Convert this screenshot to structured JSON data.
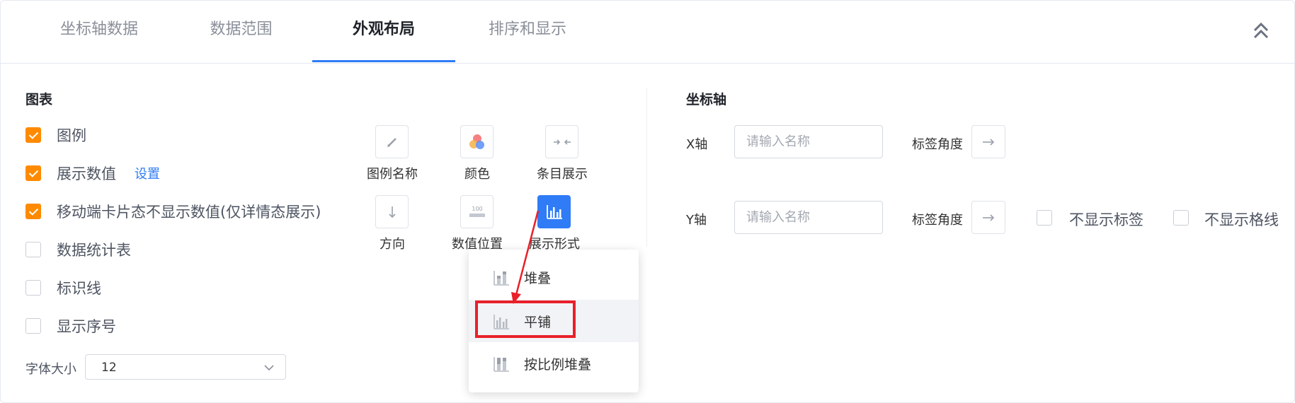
{
  "tabs": [
    {
      "label": "坐标轴数据"
    },
    {
      "label": "数据范围"
    },
    {
      "label": "外观布局"
    },
    {
      "label": "排序和显示"
    }
  ],
  "active_tab": "外观布局",
  "chart_section": {
    "title": "图表",
    "options": [
      {
        "label": "图例",
        "checked": true
      },
      {
        "label": "展示数值",
        "checked": true,
        "link": "设置"
      },
      {
        "label": "移动端卡片态不显示数值(仅详情态展示)",
        "checked": true
      },
      {
        "label": "数据统计表",
        "checked": false
      },
      {
        "label": "标识线",
        "checked": false
      },
      {
        "label": "显示序号",
        "checked": false
      }
    ],
    "font_size": {
      "label": "字体大小",
      "value": "12"
    },
    "icon_buttons": [
      {
        "label": "图例名称",
        "icon": "pencil-icon"
      },
      {
        "label": "颜色",
        "icon": "color-palette-icon"
      },
      {
        "label": "条目展示",
        "icon": "collapse-arrows-icon"
      },
      {
        "label": "方向",
        "icon": "arrow-down-icon"
      },
      {
        "label": "数值位置",
        "icon": "value-position-icon"
      },
      {
        "label": "展示形式",
        "icon": "bar-chart-icon",
        "active": true
      }
    ]
  },
  "axis_section": {
    "title": "坐标轴",
    "x_axis": {
      "label": "X轴",
      "placeholder": "请输入名称",
      "angle_label": "标签角度"
    },
    "y_axis": {
      "label": "Y轴",
      "placeholder": "请输入名称",
      "angle_label": "标签角度",
      "hide_labels": "不显示标签",
      "hide_gridlines": "不显示格线"
    }
  },
  "display_form_menu": {
    "items": [
      {
        "label": "堆叠",
        "icon": "stacked-bar-icon"
      },
      {
        "label": "平铺",
        "icon": "grouped-bar-icon",
        "highlighted": true
      },
      {
        "label": "按比例堆叠",
        "icon": "percent-stacked-bar-icon"
      }
    ]
  },
  "colors": {
    "accent": "#2f7cf6",
    "checkbox": "#ff8a00",
    "annotation": "#e8202a"
  }
}
